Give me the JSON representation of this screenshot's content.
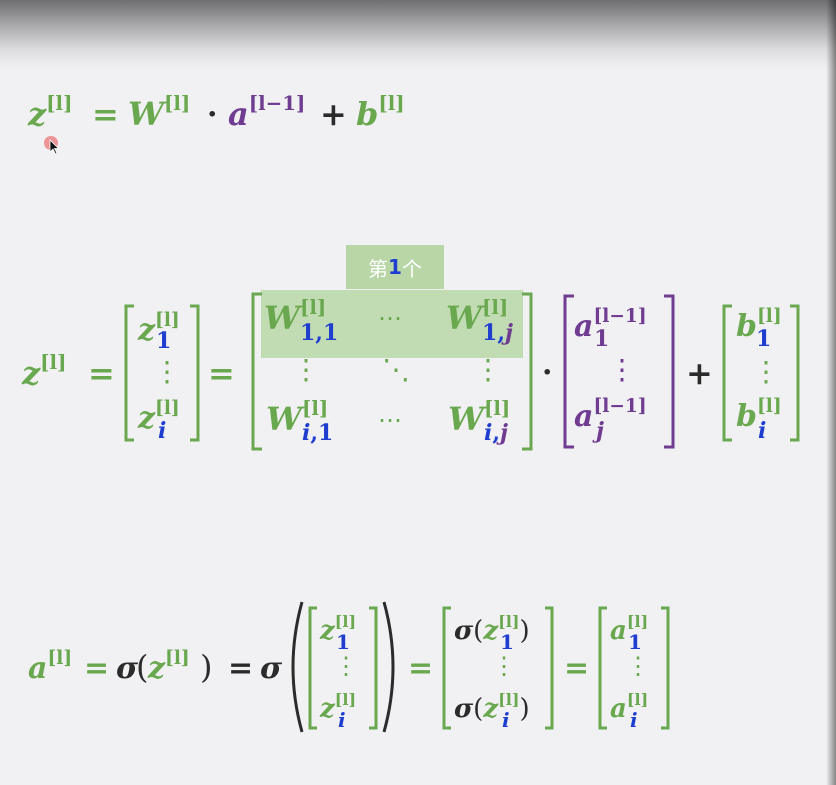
{
  "colors": {
    "green": "#6aa84f",
    "purple": "#6f3c91",
    "blue": "#1f3ecf",
    "black": "#2b2b2b",
    "highlight": "#b9d7a6"
  },
  "badge": {
    "prefix": "第",
    "number": "1",
    "suffix": "个"
  },
  "symbols": {
    "z": "z",
    "W": "W",
    "a": "a",
    "b": "b",
    "sigma": "σ",
    "layer": "[l]",
    "prev_layer": "[l−1]",
    "eq": "=",
    "plus": "+",
    "dot": "·",
    "hdots": "⋯",
    "vdots": "⋮",
    "ddots": "⋱",
    "lparen": "(",
    "rparen": ")",
    "one": "1",
    "i": "i",
    "j": "j",
    "one_one": "1,1",
    "one_j": "1,j",
    "i_one": "i,1",
    "i_j": "i,j"
  },
  "icons": {
    "cursor": "mouse-pointer-icon"
  }
}
